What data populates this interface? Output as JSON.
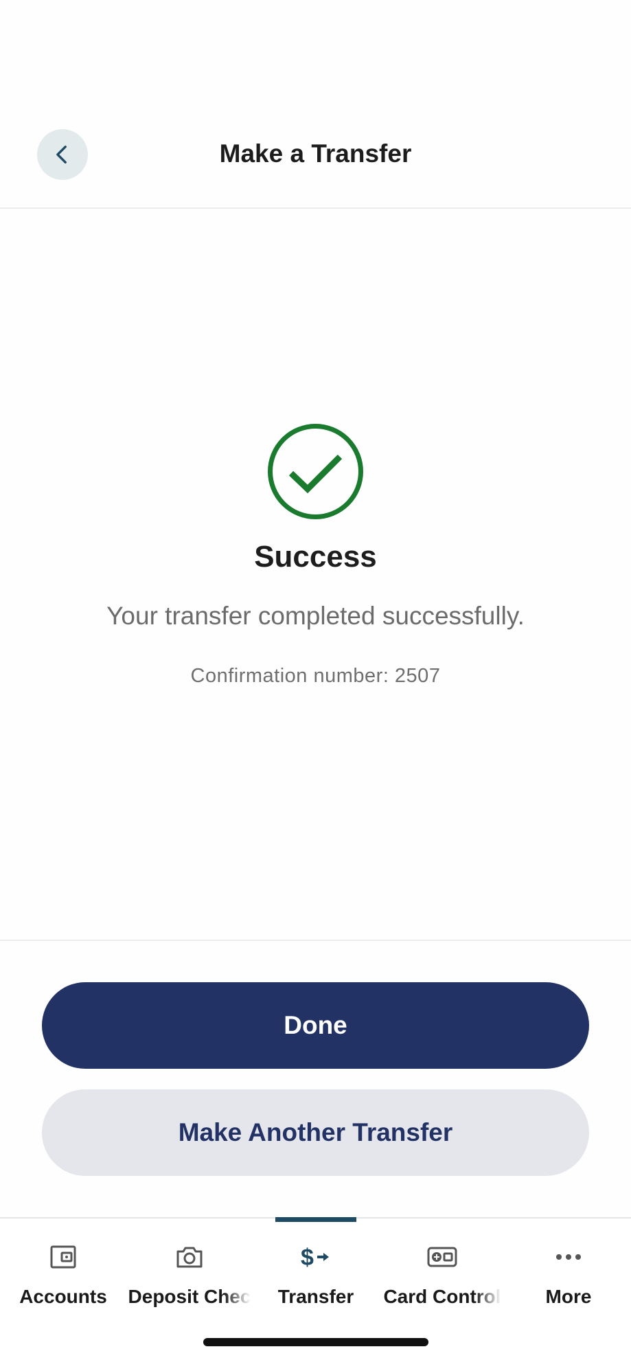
{
  "header": {
    "title": "Make a Transfer",
    "back_icon": "chevron-left-icon"
  },
  "success": {
    "icon": "check-circle-icon",
    "icon_color": "#1a7a2e",
    "title": "Success",
    "message": "Your transfer completed successfully.",
    "confirmation": "Confirmation number: 2507"
  },
  "actions": {
    "done_label": "Done",
    "another_label": "Make Another Transfer"
  },
  "bottom_nav": {
    "active": "Transfer",
    "items": [
      {
        "label": "Accounts",
        "icon": "wallet-icon"
      },
      {
        "label": "Deposit Chec",
        "icon": "camera-icon"
      },
      {
        "label": "Transfer",
        "icon": "dollar-arrow-icon"
      },
      {
        "label": "Card Control",
        "icon": "card-control-icon"
      },
      {
        "label": "More",
        "icon": "more-dots-icon"
      }
    ]
  },
  "colors": {
    "primary": "#233264",
    "secondary_button": "#e4e6eb",
    "active_nav": "#1e4a63",
    "success": "#1a7a2e"
  }
}
